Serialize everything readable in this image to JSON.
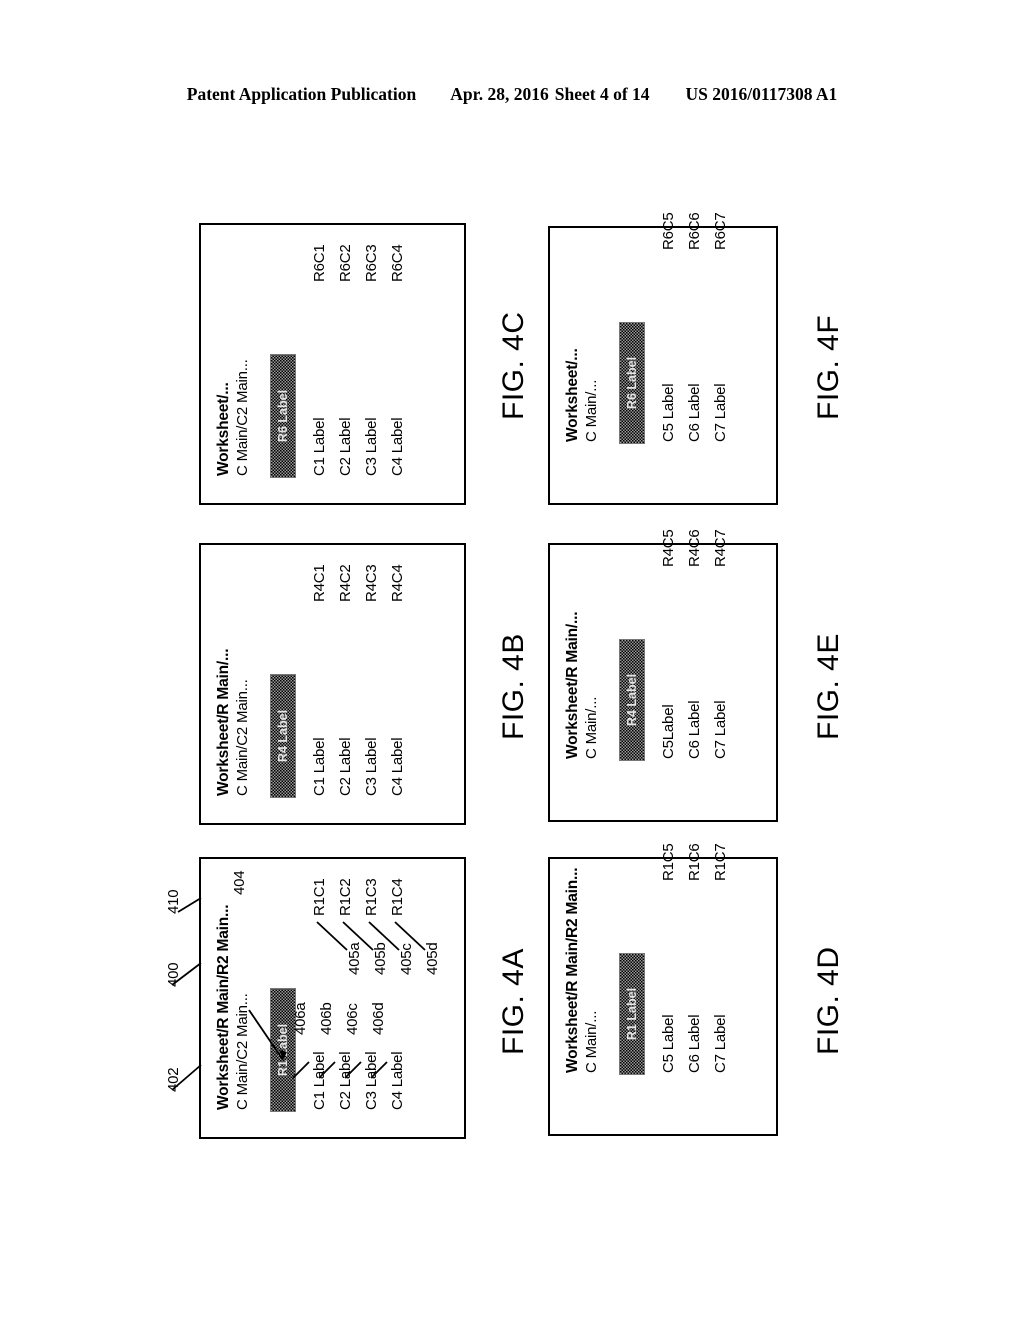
{
  "page_header": {
    "publication": "Patent Application Publication",
    "date": "Apr. 28, 2016",
    "sheet": "Sheet 4 of 14",
    "number": "US 2016/0117308 A1"
  },
  "figures": [
    {
      "id": "fig-4c",
      "caption": "FIG. 4C",
      "breadcrumb_title": "Worksheet/...",
      "breadcrumb_sub": "C Main/C2 Main...",
      "row_label": "R6 Label",
      "column_labels": [
        "C1 Label",
        "C2 Label",
        "C3 Label",
        "C4 Label"
      ],
      "values": [
        "R6C1",
        "R6C2",
        "R6C3",
        "R6C4"
      ]
    },
    {
      "id": "fig-4b",
      "caption": "FIG. 4B",
      "breadcrumb_title": "Worksheet/R Main/...",
      "breadcrumb_sub": "C Main/C2 Main...",
      "row_label": "R4 Label",
      "column_labels": [
        "C1 Label",
        "C2 Label",
        "C3 Label",
        "C4 Label"
      ],
      "values": [
        "R4C1",
        "R4C2",
        "R4C3",
        "R4C4"
      ]
    },
    {
      "id": "fig-4a",
      "caption": "FIG. 4A",
      "breadcrumb_title": "Worksheet/R Main/R2 Main...",
      "breadcrumb_sub": "C Main/C2 Main...",
      "row_label": "R1 Label",
      "column_labels": [
        "C1 Label",
        "C2 Label",
        "C3 Label",
        "C4 Label"
      ],
      "values": [
        "R1C1",
        "R1C2",
        "R1C3",
        "R1C4"
      ]
    },
    {
      "id": "fig-4f",
      "caption": "FIG. 4F",
      "breadcrumb_title": "Worksheet/...",
      "breadcrumb_sub": "C Main/...",
      "row_label": "R6 Label",
      "column_labels": [
        "C5 Label",
        "C6 Label",
        "C7 Label"
      ],
      "values": [
        "R6C5",
        "R6C6",
        "R6C7"
      ]
    },
    {
      "id": "fig-4e",
      "caption": "FIG. 4E",
      "breadcrumb_title": "Worksheet/R Main/...",
      "breadcrumb_sub": "C Main/...",
      "row_label": "R4 Label",
      "column_labels": [
        "C5Label",
        "C6 Label",
        "C7 Label"
      ],
      "values": [
        "R4C5",
        "R4C6",
        "R4C7"
      ]
    },
    {
      "id": "fig-4d",
      "caption": "FIG. 4D",
      "breadcrumb_title": "Worksheet/R Main/R2 Main...",
      "breadcrumb_sub": "C Main/...",
      "row_label": "R1 Label",
      "column_labels": [
        "C5 Label",
        "C6 Label",
        "C7 Label"
      ],
      "values": [
        "R1C5",
        "R1C6",
        "R1C7"
      ]
    }
  ],
  "reference_numerals": {
    "figure_frame": "402",
    "breadcrumb_row": "400",
    "breadcrumb_column": "410",
    "row_label_box": "404",
    "value_callouts": [
      "405a",
      "405b",
      "405c",
      "405d"
    ],
    "label_callouts": [
      "406a",
      "406b",
      "406c",
      "406d"
    ]
  }
}
